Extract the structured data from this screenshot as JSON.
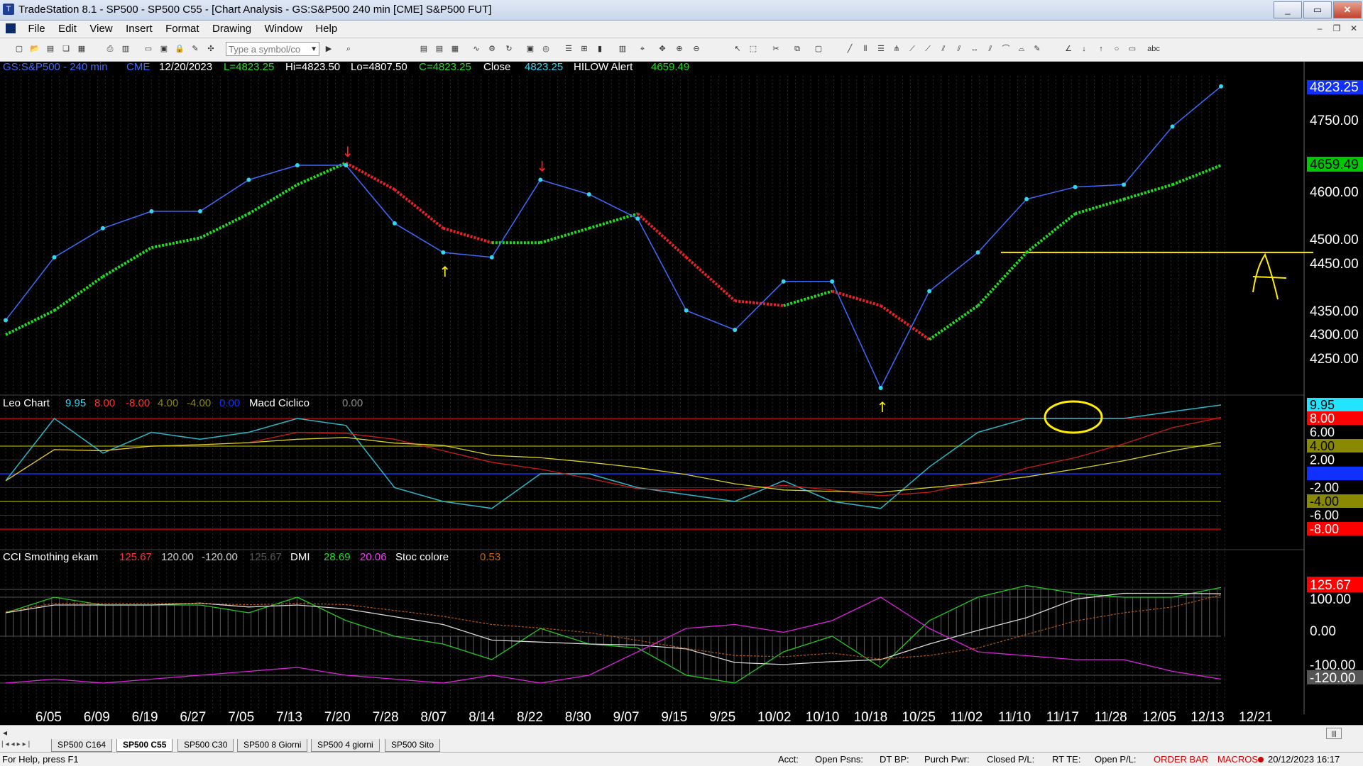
{
  "window": {
    "title": "TradeStation 8.1 - SP500 - SP500 C55 - [Chart Analysis - GS:S&P500  240 min  [CME] S&P500 FUT]"
  },
  "menu": {
    "items": [
      "File",
      "Edit",
      "View",
      "Insert",
      "Format",
      "Drawing",
      "Window",
      "Help"
    ]
  },
  "toolbar": {
    "symbol_placeholder": "Type a symbol/co"
  },
  "price_header": {
    "symbol": "GS:S&P500 - 240 min",
    "exchange": "CME",
    "date": "12/20/2023",
    "low_label": "L=4823.25",
    "high_label": "Hi=4823.50",
    "lo_label": "Lo=4807.50",
    "close_label": "C=4823.25",
    "close_word": "Close",
    "close_value": "4823.25",
    "alert_name": "HILOW Alert",
    "alert_value": "4659.49"
  },
  "price_axis": {
    "ticks": [
      "4750.00",
      "4600.00",
      "4500.00",
      "4450.00",
      "4350.00",
      "4300.00",
      "4250.00"
    ],
    "last_price_label": "4823.25",
    "indicator_label": "4659.49",
    "hline_value": 4480,
    "annotation": "A"
  },
  "leo_header": {
    "name": "Leo Chart",
    "v1": "9.95",
    "v2": "8.00",
    "v3": "-8.00",
    "v4": "4.00",
    "v5": "-4.00",
    "v6": "0.00",
    "name2": "Macd Ciclico",
    "v7": "0.00"
  },
  "leo_axis": {
    "labels": [
      {
        "text": "9.95",
        "bg": "#22e4ff",
        "fg": "#000000"
      },
      {
        "text": "8.00",
        "bg": "#ff0000",
        "fg": "#ffffff"
      },
      {
        "text": "6.00",
        "bg": "",
        "fg": "#ffffff"
      },
      {
        "text": "4.00",
        "bg": "#8a8a00",
        "fg": "#000000"
      },
      {
        "text": "2.00",
        "bg": "",
        "fg": "#ffffff"
      },
      {
        "text": "0.00",
        "bg": "#1030ff",
        "fg": "#1030ff"
      },
      {
        "text": "-2.00",
        "bg": "",
        "fg": "#ffffff"
      },
      {
        "text": "-4.00",
        "bg": "#8a8a00",
        "fg": "#000000"
      },
      {
        "text": "-6.00",
        "bg": "",
        "fg": "#ffffff"
      },
      {
        "text": "-8.00",
        "bg": "#ff0000",
        "fg": "#ffffff"
      }
    ]
  },
  "cci_header": {
    "name": "CCI Smothing ekam",
    "v1": "125.67",
    "v2": "120.00",
    "v3": "-120.00",
    "v4": "125.67",
    "name2": "DMI",
    "v5": "28.69",
    "v6": "20.06",
    "name3": "Stoc colore",
    "v7": "0.53"
  },
  "cci_axis": {
    "labels": [
      "125.67",
      "100.00",
      "0.00",
      "-100.00",
      "-120.00"
    ]
  },
  "time_axis": {
    "labels": [
      "6/05",
      "6/09",
      "6/19",
      "6/27",
      "7/05",
      "7/13",
      "7/20",
      "7/28",
      "8/07",
      "8/14",
      "8/22",
      "8/30",
      "9/07",
      "9/15",
      "9/25",
      "10/02",
      "10/10",
      "10/18",
      "10/25",
      "11/02",
      "11/10",
      "11/17",
      "11/28",
      "12/05",
      "12/13",
      "12/21"
    ]
  },
  "tabs": [
    "SP500 C164",
    "SP500 C55",
    "SP500 C30",
    "SP500 8 Giorni",
    "SP500 4 giorni",
    "SP500 Sito"
  ],
  "active_tab": 1,
  "status": {
    "help": "For Help, press F1",
    "acct": "Acct:",
    "open_psns": "Open Psns:",
    "dt_bp": "DT BP:",
    "purch_pwr": "Purch Pwr:",
    "closed_pl": "Closed P/L:",
    "rt_te": "RT TE:",
    "open_pl": "Open P/L:",
    "order_bar": "ORDER BAR",
    "macros": "MACROS",
    "datetime": "20/12/2023 16:17"
  },
  "colors": {
    "price": "#33d7f0",
    "avg_up": "#22dd22",
    "avg_down": "#ee2222",
    "alert_up": "#ffee00",
    "alert_down": "#ff2222"
  },
  "chart_data": {
    "type": "line",
    "price_series": {
      "name": "GS:S&P500 - 240 min",
      "x": [
        "6/05",
        "6/09",
        "6/19",
        "6/27",
        "7/05",
        "7/13",
        "7/20",
        "7/28",
        "8/07",
        "8/14",
        "8/22",
        "8/30",
        "9/07",
        "9/15",
        "9/25",
        "10/02",
        "10/10",
        "10/18",
        "10/25",
        "11/02",
        "11/10",
        "11/17",
        "11/28",
        "12/05",
        "12/13",
        "12/20"
      ],
      "values": [
        4340,
        4470,
        4530,
        4565,
        4565,
        4630,
        4660,
        4660,
        4540,
        4480,
        4470,
        4630,
        4600,
        4550,
        4360,
        4320,
        4420,
        4420,
        4200,
        4400,
        4480,
        4590,
        4615,
        4620,
        4740,
        4823
      ]
    },
    "avg_series": {
      "values": [
        4310,
        4360,
        4430,
        4490,
        4510,
        4560,
        4620,
        4665,
        4610,
        4530,
        4500,
        4500,
        4530,
        4560,
        4470,
        4380,
        4370,
        4400,
        4370,
        4300,
        4370,
        4480,
        4560,
        4590,
        4620,
        4660
      ]
    },
    "leo_series": {
      "values": [
        -1,
        8,
        3,
        6,
        5,
        6,
        8,
        7,
        -2,
        -4,
        -5,
        0,
        0,
        -2,
        -3,
        -4,
        -1,
        -4,
        -5,
        1,
        6,
        8,
        8,
        8,
        9,
        9.95
      ]
    },
    "cci_series": {
      "values": [
        60,
        100,
        80,
        80,
        80,
        60,
        100,
        40,
        0,
        -20,
        -60,
        20,
        -20,
        -30,
        -100,
        -120,
        -40,
        0,
        -80,
        40,
        100,
        130,
        110,
        100,
        100,
        125
      ]
    },
    "dmi_series": {
      "values": [
        -120,
        -110,
        -120,
        -110,
        -100,
        -90,
        -80,
        -100,
        -110,
        -120,
        -100,
        -120,
        -100,
        -40,
        20,
        30,
        10,
        40,
        100,
        20,
        -40,
        -50,
        -60,
        -60,
        -90,
        -110
      ]
    },
    "ylim_price": [
      4200,
      4830
    ]
  }
}
